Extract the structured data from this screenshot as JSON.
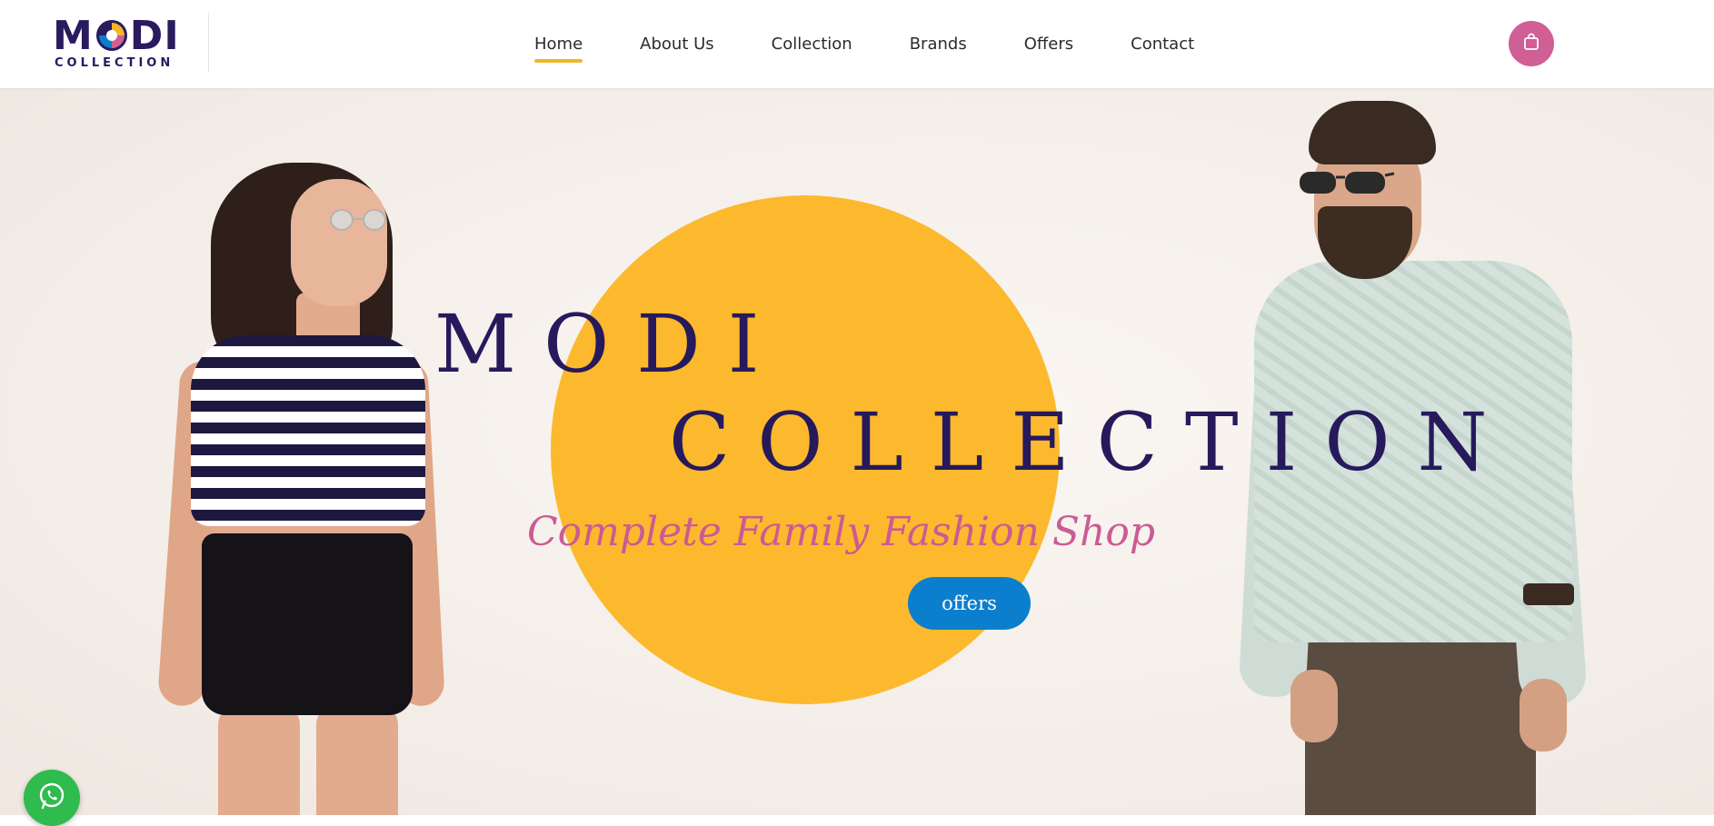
{
  "brand": {
    "logo_main": "MODI",
    "logo_sub": "COLLECTION",
    "logo_letter_m": "M",
    "logo_letters_di": "DI"
  },
  "nav": {
    "items": [
      {
        "label": "Home",
        "active": true
      },
      {
        "label": "About Us",
        "active": false
      },
      {
        "label": "Collection",
        "active": false
      },
      {
        "label": "Brands",
        "active": false
      },
      {
        "label": "Offers",
        "active": false
      },
      {
        "label": "Contact",
        "active": false
      }
    ]
  },
  "header": {
    "cart_icon": "shopping-bag-icon",
    "cart_color": "#cf5f95",
    "active_underline_color": "#f2b52b"
  },
  "hero": {
    "title_line1": "MODI",
    "title_line2": "COLLECTION",
    "tagline": "Complete Family Fashion Shop",
    "cta_label": "offers",
    "circle_color": "#fcb92e",
    "title_color": "#261a5c",
    "tagline_color": "#cb5b93",
    "cta_color": "#0b7fcd"
  },
  "floating": {
    "whatsapp_icon": "whatsapp-icon",
    "whatsapp_color": "#2fbb4d"
  }
}
